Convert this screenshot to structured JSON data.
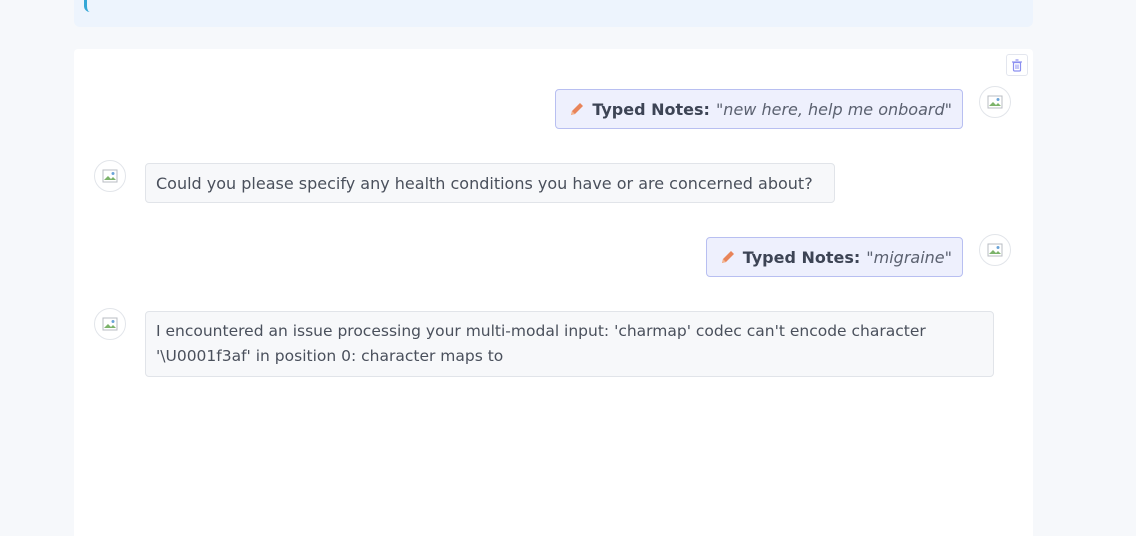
{
  "chat": {
    "clear_button_icon": "trash-icon",
    "messages": [
      {
        "role": "user",
        "icon": "pencil-icon",
        "label": "Typed Notes:",
        "text": "\"new here, help me onboard\""
      },
      {
        "role": "assistant",
        "text": "Could you please specify any health conditions you have or are concerned about?"
      },
      {
        "role": "user",
        "icon": "pencil-icon",
        "label": "Typed Notes:",
        "text": "\"migraine\""
      },
      {
        "role": "assistant",
        "text": "I encountered an issue processing your multi-modal input: 'charmap' codec can't encode character '\\U0001f3af' in position 0: character maps to"
      }
    ]
  },
  "colors": {
    "user_bubble_bg": "#eef0fd",
    "user_bubble_border": "#b8bff1",
    "bot_bubble_bg": "#f7f8fa",
    "pencil_icon": "#e8845a",
    "trash_icon": "#8b8ff0"
  }
}
